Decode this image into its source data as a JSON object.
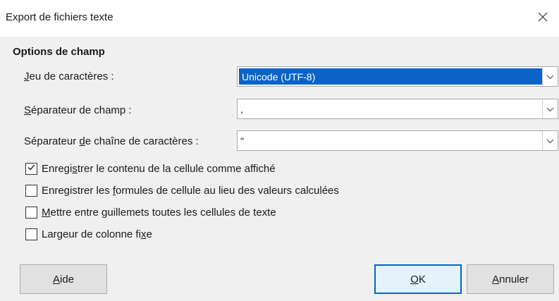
{
  "window": {
    "title": "Export de fichiers texte",
    "close_icon": "close-icon"
  },
  "section": {
    "title": "Options de champ"
  },
  "fields": {
    "charset": {
      "label_accel": "J",
      "label_rest": "eu de caractères :",
      "value": "Unicode (UTF-8)"
    },
    "field_separator": {
      "label_accel": "S",
      "label_rest": "éparateur de champ :",
      "value": ","
    },
    "string_separator": {
      "label_pre": "Séparateur ",
      "label_accel": "d",
      "label_rest": "e chaîne de caractères :",
      "value": "\""
    }
  },
  "options": {
    "save_as_shown": {
      "label_pre": "Enregi",
      "label_accel": "s",
      "label_rest": "trer le contenu de la cellule comme affiché",
      "checked": true
    },
    "save_formulas": {
      "label_pre": "Enregistrer les ",
      "label_accel": "f",
      "label_rest": "ormules de cellule au lieu des valeurs calculées",
      "checked": false
    },
    "quote_all": {
      "label_pre": "",
      "label_accel": "M",
      "label_rest": "ettre entre guillemets toutes les cellules de texte",
      "checked": false
    },
    "fixed_width": {
      "label_pre": "Largeur de colonne fi",
      "label_accel": "x",
      "label_rest": "e",
      "checked": false
    }
  },
  "buttons": {
    "help": {
      "accel": "A",
      "rest": "ide"
    },
    "ok": {
      "accel": "O",
      "rest": "K"
    },
    "cancel": {
      "accel": "A",
      "rest": "nnuler"
    }
  },
  "colors": {
    "selection": "#0a64c8",
    "dialog_bg": "#f0f0f0"
  }
}
